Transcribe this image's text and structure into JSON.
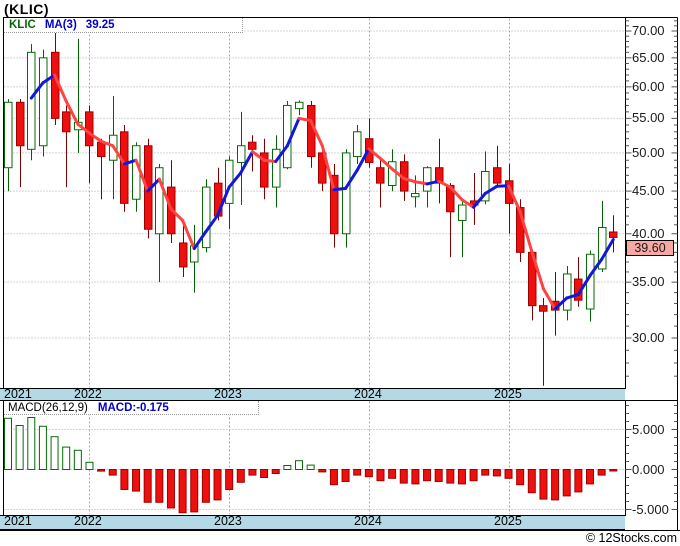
{
  "header": {
    "title": "(KLIC)"
  },
  "watermark": "© 12Stocks.com",
  "main_panel": {
    "legend": {
      "symbol": "KLIC",
      "ma_label": "MA(3)",
      "ma_value": "39.25"
    },
    "price_tag": "39.60",
    "y_axis_labels": [
      "70.00",
      "65.00",
      "60.00",
      "55.00",
      "50.00",
      "45.00",
      "40.00",
      "35.00",
      "30.00"
    ],
    "y_axis_values": [
      70,
      65,
      60,
      55,
      50,
      45,
      40,
      35,
      30
    ]
  },
  "macd_panel": {
    "legend": {
      "name": "MACD(26,12,9)",
      "value": "MACD:-0.175"
    },
    "y_axis_labels": [
      "5.000",
      "0.000",
      "-5.000"
    ],
    "y_axis_values": [
      5,
      0,
      -5
    ]
  },
  "x_axis": {
    "years": [
      "2021",
      "2022",
      "2023",
      "2024",
      "2025"
    ],
    "year_indices": [
      0,
      7,
      19,
      31,
      43
    ]
  },
  "colors": {
    "up_stroke": "#066a06",
    "up_fill": "#ffffff",
    "up_wick": "#056105",
    "down_stroke": "#a00000",
    "down_fill": "#ee0f0f",
    "down_wick": "#7e0000",
    "ma_up": "#1616d9",
    "ma_down": "#ff4343",
    "grid": "#aaaaaa",
    "band_bg": "#b3d9e7",
    "tag_bg": "#f6a9a2",
    "legend_symbol": "#066a06",
    "legend_blue": "#0000cc"
  },
  "chart_data": [
    {
      "type": "candlestick",
      "title": "KLIC monthly price with MA(3)",
      "scale": "log",
      "ylim": [
        26,
        72.5
      ],
      "gridlines": [
        70,
        65,
        60,
        55,
        50,
        45,
        40,
        35,
        30
      ],
      "ma_period": 3,
      "ma_last_value": 39.25,
      "last_close": 39.6,
      "ohlc": [
        [
          48,
          58,
          45,
          57.5
        ],
        [
          57.5,
          58,
          45.5,
          51
        ],
        [
          50.5,
          67.5,
          49,
          66
        ],
        [
          51,
          66.5,
          49.5,
          65
        ],
        [
          66,
          70.5,
          54,
          55
        ],
        [
          56,
          57,
          45.5,
          53
        ],
        [
          53.3,
          68.5,
          50,
          54.4
        ],
        [
          56,
          57,
          46,
          51
        ],
        [
          51.5,
          52,
          44,
          49.5
        ],
        [
          49,
          58.5,
          44,
          52.5
        ],
        [
          53,
          54,
          42.5,
          43.5
        ],
        [
          44,
          51.5,
          42.5,
          51
        ],
        [
          51,
          52,
          39.5,
          40.5
        ],
        [
          40,
          48.5,
          35,
          48
        ],
        [
          45.5,
          49,
          39,
          40
        ],
        [
          39,
          41.5,
          35.5,
          36.5
        ],
        [
          37,
          41,
          34,
          38.7
        ],
        [
          38.5,
          46.5,
          38,
          45.5
        ],
        [
          46,
          48,
          41.5,
          42
        ],
        [
          43.5,
          49.5,
          40.5,
          49
        ],
        [
          48.7,
          56,
          43.3,
          51
        ],
        [
          51.5,
          52.5,
          47.5,
          50.5
        ],
        [
          50,
          52,
          44,
          45.5
        ],
        [
          45.5,
          52.5,
          43,
          50.5
        ],
        [
          48,
          57.7,
          47.8,
          57
        ],
        [
          56.5,
          57.8,
          55.5,
          57.5
        ],
        [
          57,
          57.7,
          48,
          49.5
        ],
        [
          50,
          50.5,
          45,
          46
        ],
        [
          47,
          48.5,
          38.5,
          40
        ],
        [
          40,
          50.5,
          38.5,
          50
        ],
        [
          49.5,
          54,
          48.5,
          53
        ],
        [
          52,
          55,
          48,
          48.7
        ],
        [
          48,
          49,
          43,
          46
        ],
        [
          45.7,
          50.5,
          45,
          48.8
        ],
        [
          48.8,
          49.8,
          43.8,
          45
        ],
        [
          44.3,
          47,
          43,
          44.7
        ],
        [
          45,
          48.2,
          43,
          48
        ],
        [
          48,
          52,
          43.5,
          46
        ],
        [
          45.7,
          46,
          37.5,
          42.5
        ],
        [
          41.5,
          43.7,
          37.5,
          43.3
        ],
        [
          43.8,
          47.3,
          41,
          43.3
        ],
        [
          43.8,
          50.2,
          43.4,
          47.5
        ],
        [
          48,
          51,
          45.7,
          46
        ],
        [
          46.3,
          48.5,
          40,
          43.5
        ],
        [
          43,
          44,
          37,
          38
        ],
        [
          38,
          38.2,
          31.5,
          32.8
        ],
        [
          32.8,
          33.5,
          26.3,
          32.3
        ],
        [
          33.2,
          36,
          30.2,
          32.4
        ],
        [
          32.4,
          36.6,
          31.5,
          35.8
        ],
        [
          35.3,
          37.5,
          32.7,
          33.3
        ],
        [
          32.5,
          38.2,
          31.4,
          37.8
        ],
        [
          36.3,
          43.8,
          36,
          40.7
        ],
        [
          40.2,
          42.1,
          38,
          39.6
        ]
      ]
    },
    {
      "type": "bar",
      "title": "MACD(26,12,9) histogram",
      "ylim": [
        -5.7,
        8.7
      ],
      "gridlines": [
        5,
        0,
        -5
      ],
      "last_value": -0.175,
      "values": [
        6.4,
        5.5,
        6.5,
        5.4,
        4.1,
        2.8,
        2.4,
        0.9,
        -0.2,
        -0.7,
        -2.5,
        -2.7,
        -4.1,
        -4.1,
        -4.8,
        -5.4,
        -5.3,
        -4.1,
        -3.8,
        -2.5,
        -1.6,
        -0.7,
        -1.0,
        -0.5,
        0.5,
        1.1,
        0.55,
        -0.3,
        -1.9,
        -1.5,
        -0.7,
        -0.9,
        -1.4,
        -1.1,
        -1.7,
        -1.8,
        -1.4,
        -1.5,
        -1.7,
        -1.8,
        -1.4,
        -0.7,
        -0.8,
        -1.1,
        -1.9,
        -2.9,
        -3.7,
        -3.8,
        -3.3,
        -2.8,
        -1.8,
        -0.7,
        -0.175
      ]
    }
  ]
}
